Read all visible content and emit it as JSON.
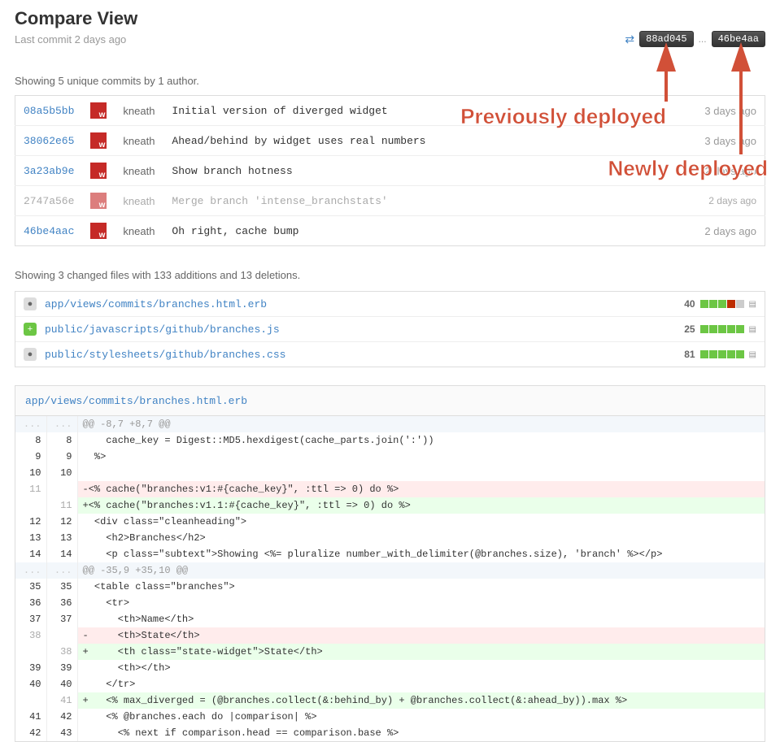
{
  "header": {
    "title": "Compare View",
    "subtitle": "Last commit 2 days ago",
    "sha_from": "88ad045",
    "sha_to": "46be4aa",
    "ellipsis": "..."
  },
  "annotations": {
    "prev": "Previously deployed",
    "new": "Newly deployed"
  },
  "commits_summary": "Showing 5 unique commits by 1 author.",
  "commits": [
    {
      "sha": "08a5b5bb",
      "author": "kneath",
      "msg": "Initial version of diverged widget",
      "time": "3 days ago",
      "muted": false
    },
    {
      "sha": "38062e65",
      "author": "kneath",
      "msg": "Ahead/behind by widget uses real numbers",
      "time": "3 days ago",
      "muted": false
    },
    {
      "sha": "3a23ab9e",
      "author": "kneath",
      "msg": "Show branch hotness",
      "time": "2 days ago",
      "muted": false
    },
    {
      "sha": "2747a56e",
      "author": "kneath",
      "msg": "Merge branch 'intense_branchstats'",
      "time": "2 days ago",
      "muted": true
    },
    {
      "sha": "46be4aac",
      "author": "kneath",
      "msg": "Oh right, cache bump",
      "time": "2 days ago",
      "muted": false
    }
  ],
  "diff_summary": "Showing 3 changed files with 133 additions and 13 deletions.",
  "files": [
    {
      "badge": "mod",
      "badge_char": "●",
      "path": "app/views/commits/branches.html.erb",
      "count": "40",
      "blocks": [
        "g",
        "g",
        "g",
        "r",
        "n"
      ]
    },
    {
      "badge": "add",
      "badge_char": "+",
      "path": "public/javascripts/github/branches.js",
      "count": "25",
      "blocks": [
        "g",
        "g",
        "g",
        "g",
        "g"
      ]
    },
    {
      "badge": "mod",
      "badge_char": "●",
      "path": "public/stylesheets/github/branches.css",
      "count": "81",
      "blocks": [
        "g",
        "g",
        "g",
        "g",
        "g"
      ]
    }
  ],
  "diff_file": {
    "path": "app/views/commits/branches.html.erb",
    "rows": [
      {
        "t": "hunk",
        "l": "...",
        "r": "...",
        "code": "@@ -8,7 +8,7 @@"
      },
      {
        "t": "ctx",
        "l": "8",
        "r": "8",
        "code": "    cache_key = Digest::MD5.hexdigest(cache_parts.join(':'))"
      },
      {
        "t": "ctx",
        "l": "9",
        "r": "9",
        "code": "  %>"
      },
      {
        "t": "ctx",
        "l": "10",
        "r": "10",
        "code": ""
      },
      {
        "t": "del",
        "l": "11",
        "r": "",
        "code": "-<% cache(\"branches:v1:#{cache_key}\", :ttl => 0) do %>"
      },
      {
        "t": "add",
        "l": "",
        "r": "11",
        "code": "+<% cache(\"branches:v1.1:#{cache_key}\", :ttl => 0) do %>"
      },
      {
        "t": "ctx",
        "l": "12",
        "r": "12",
        "code": "  <div class=\"cleanheading\">"
      },
      {
        "t": "ctx",
        "l": "13",
        "r": "13",
        "code": "    <h2>Branches</h2>"
      },
      {
        "t": "ctx",
        "l": "14",
        "r": "14",
        "code": "    <p class=\"subtext\">Showing <%= pluralize number_with_delimiter(@branches.size), 'branch' %></p>"
      },
      {
        "t": "hunk",
        "l": "...",
        "r": "...",
        "code": "@@ -35,9 +35,10 @@"
      },
      {
        "t": "ctx",
        "l": "35",
        "r": "35",
        "code": "  <table class=\"branches\">"
      },
      {
        "t": "ctx",
        "l": "36",
        "r": "36",
        "code": "    <tr>"
      },
      {
        "t": "ctx",
        "l": "37",
        "r": "37",
        "code": "      <th>Name</th>"
      },
      {
        "t": "del",
        "l": "38",
        "r": "",
        "code": "-     <th>State</th>"
      },
      {
        "t": "add",
        "l": "",
        "r": "38",
        "code": "+     <th class=\"state-widget\">State</th>"
      },
      {
        "t": "ctx",
        "l": "39",
        "r": "39",
        "code": "      <th></th>"
      },
      {
        "t": "ctx",
        "l": "40",
        "r": "40",
        "code": "    </tr>"
      },
      {
        "t": "add",
        "l": "",
        "r": "41",
        "code": "+   <% max_diverged = (@branches.collect(&:behind_by) + @branches.collect(&:ahead_by)).max %>"
      },
      {
        "t": "ctx",
        "l": "41",
        "r": "42",
        "code": "    <% @branches.each do |comparison| %>"
      },
      {
        "t": "ctx",
        "l": "42",
        "r": "43",
        "code": "      <% next if comparison.head == comparison.base %>"
      }
    ]
  }
}
